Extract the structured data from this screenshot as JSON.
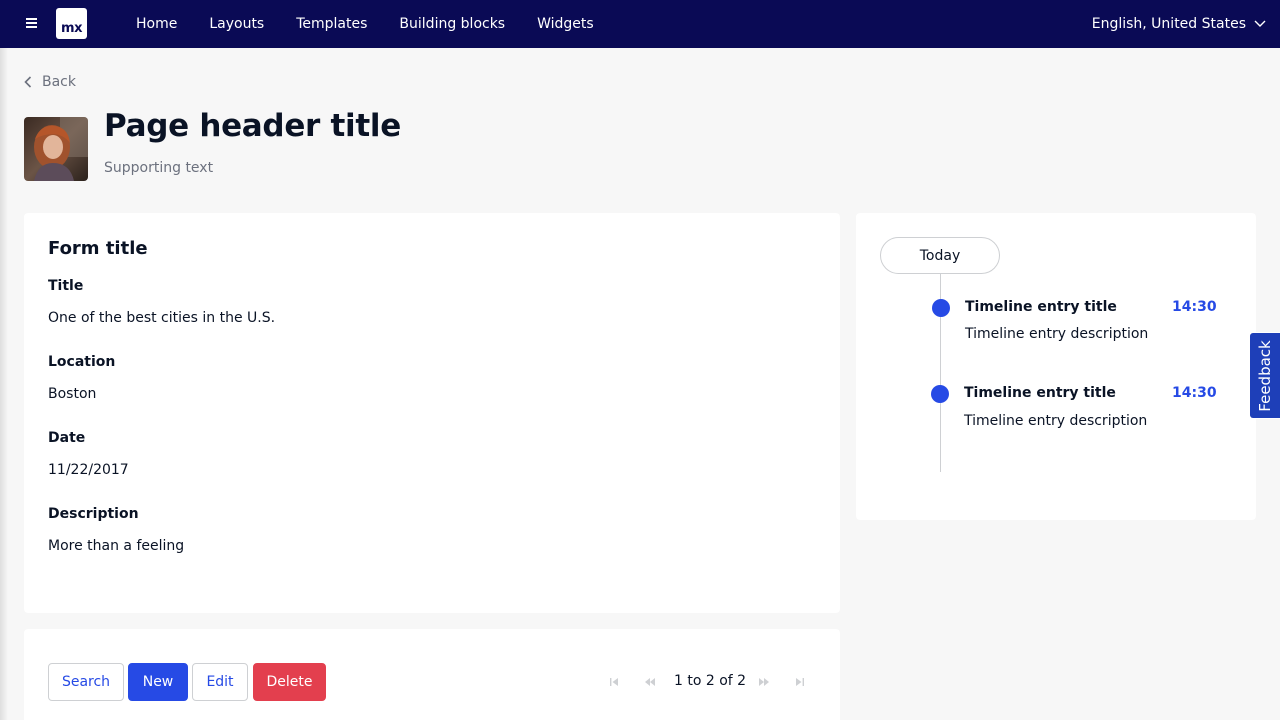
{
  "topbar": {
    "menu_icon": "hamburger-icon",
    "logo_text": "mx",
    "nav": [
      {
        "label": "Home"
      },
      {
        "label": "Layouts"
      },
      {
        "label": "Templates"
      },
      {
        "label": "Building blocks"
      },
      {
        "label": "Widgets"
      }
    ],
    "language": "English, United States",
    "language_icon": "chevron-down-icon"
  },
  "back": {
    "label": "Back",
    "icon": "chevron-left-icon"
  },
  "header": {
    "title": "Page header title",
    "supporting_text": "Supporting text",
    "avatar": "profile-photo"
  },
  "form": {
    "title": "Form title",
    "fields": [
      {
        "label": "Title",
        "value": "One of the best cities in the U.S."
      },
      {
        "label": "Location",
        "value": "Boston"
      },
      {
        "label": "Date",
        "value": "11/22/2017"
      },
      {
        "label": "Description",
        "value": "More than a feeling"
      }
    ]
  },
  "timeline": {
    "group_label": "Today",
    "entries": [
      {
        "title": "Timeline entry title",
        "time": "14:30",
        "description": "Timeline entry description"
      },
      {
        "title": "Timeline entry title",
        "time": "14:30",
        "description": "Timeline entry description"
      }
    ]
  },
  "toolbar": {
    "search_label": "Search",
    "new_label": "New",
    "edit_label": "Edit",
    "delete_label": "Delete",
    "pager_text": "1 to 2 of 2"
  },
  "feedback": {
    "label": "Feedback"
  },
  "colors": {
    "topbar": "#0a0a55",
    "primary": "#264ae5",
    "danger": "#e33f4e",
    "background": "#f7f7f7"
  }
}
